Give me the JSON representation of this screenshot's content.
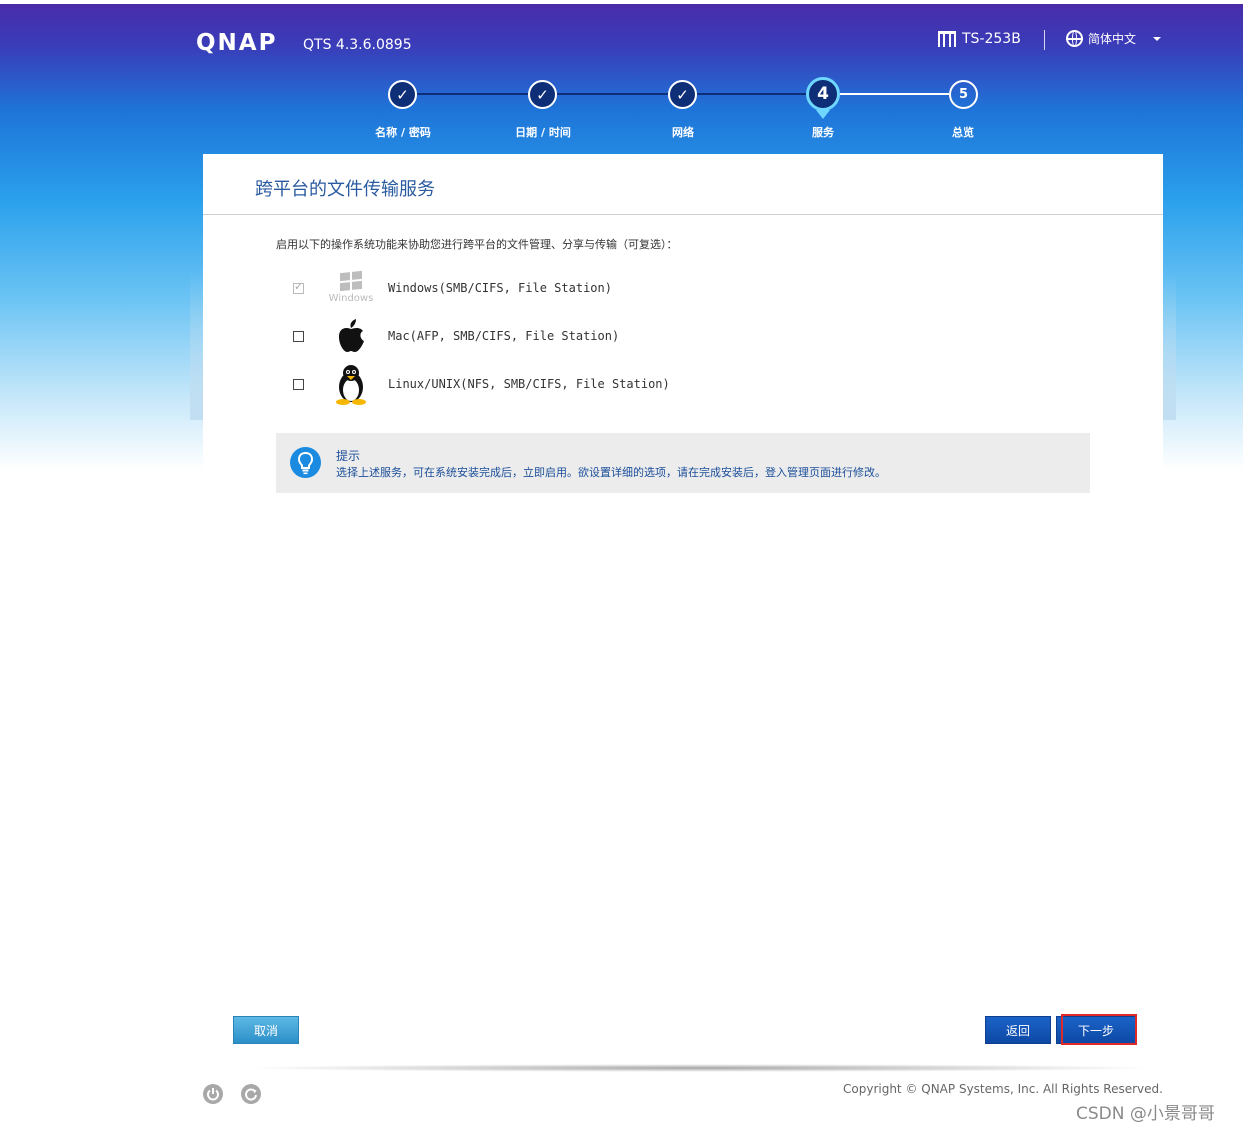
{
  "header": {
    "brand": "QNAP",
    "version": "QTS 4.3.6.0895",
    "model": "TS-253B",
    "language": "简体中文"
  },
  "steps": [
    {
      "number": "1",
      "label": "名称 / 密码",
      "status": "done"
    },
    {
      "number": "2",
      "label": "日期 / 时间",
      "status": "done"
    },
    {
      "number": "3",
      "label": "网络",
      "status": "done"
    },
    {
      "number": "4",
      "label": "服务",
      "status": "current"
    },
    {
      "number": "5",
      "label": "总览",
      "status": "todo"
    }
  ],
  "panel": {
    "title": "跨平台的文件传输服务",
    "intro": "启用以下的操作系统功能来协助您进行跨平台的文件管理、分享与传输（可复选）：",
    "options": [
      {
        "icon": "windows-icon",
        "icon_text": "Windows",
        "label": "Windows(SMB/CIFS, File Station)",
        "checked": true,
        "disabled": true
      },
      {
        "icon": "apple-icon",
        "label": "Mac(AFP, SMB/CIFS, File Station)",
        "checked": false,
        "disabled": false
      },
      {
        "icon": "linux-penguin-icon",
        "label": "Linux/UNIX(NFS, SMB/CIFS, File Station)",
        "checked": false,
        "disabled": false
      }
    ],
    "tip": {
      "title": "提示",
      "text": "选择上述服务，可在系统安装完成后，立即启用。欲设置详细的选项，请在完成安装后，登入管理页面进行修改。"
    },
    "buttons": {
      "cancel": "取消",
      "back": "返回",
      "next": "下一步"
    }
  },
  "footer": {
    "copyright": "Copyright © QNAP Systems, Inc. All Rights Reserved.",
    "watermark": "CSDN @小景哥哥"
  },
  "colors": {
    "header_top": "#4a2aa8",
    "step_done": "#0e2f78",
    "step_current_ring": "#6fd7ff",
    "primary_button": "#0d49a4",
    "cancel_button": "#2c8fc8",
    "highlight": "#e02a2a"
  }
}
